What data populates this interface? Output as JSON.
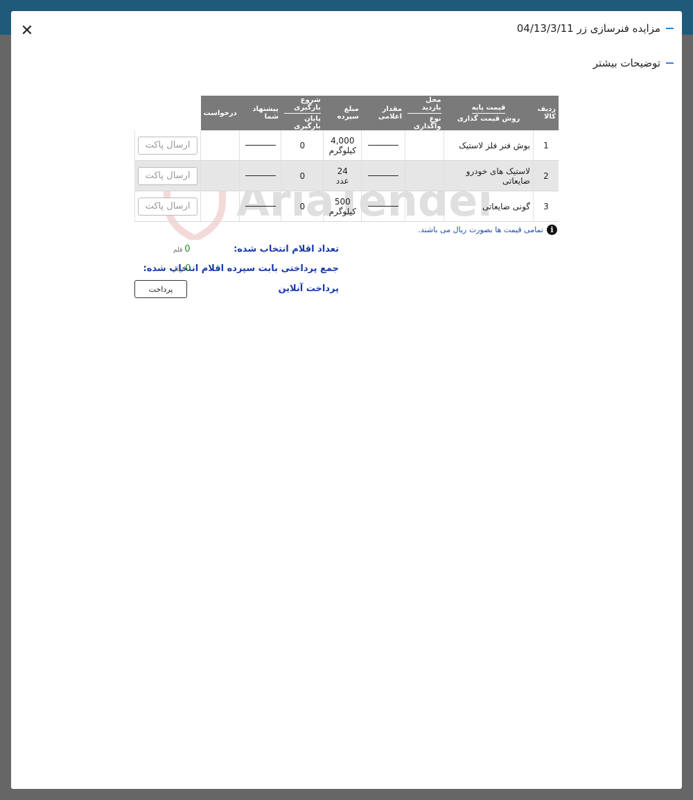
{
  "modal": {
    "title": "مزایده فنرسازی زر 04/13/3/11",
    "more_details": "توضیحات بیشتر"
  },
  "table": {
    "headers": {
      "row_item": "ردیف کالا",
      "base_price": "قیمت پایه",
      "pricing_method": "روش قیمت گذاری",
      "visit_location": "محل بازدید",
      "transfer_type": "نوع واگذاری",
      "announced_amount": "مقدار اعلامی",
      "deposit_amount": "مبلغ سپرده",
      "loading_start": "شروع بارگیری",
      "loading_end": "پایان بارگیری",
      "your_offer": "پیشنهاد شما",
      "request": "درخواست"
    },
    "rows": [
      {
        "num": "1",
        "name": "بوش فنر فلز لاستیک",
        "amount": "4,000",
        "unit": "کیلوگرم",
        "deposit": "0",
        "send": "ارسال پاکت"
      },
      {
        "num": "2",
        "name": "لاستیک های خودرو ضایعاتی",
        "amount": "24",
        "unit": "عدد",
        "deposit": "0",
        "send": "ارسال پاکت"
      },
      {
        "num": "3",
        "name": "گونی ضایعاتی",
        "amount": "500",
        "unit": "کیلوگرم",
        "deposit": "0",
        "send": "ارسال پاکت"
      }
    ]
  },
  "note": "تمامی قیمت ها بصورت ریال می باشند.",
  "summary": {
    "selected_count_label": "تعداد اقلام انتخاب شده:",
    "selected_count_value": "0",
    "selected_count_unit": "قلم",
    "deposit_total_label": "جمع پرداختی بابت سپرده اقلام انتخاب شده:",
    "deposit_total_value": "0",
    "deposit_total_unit": "ریال",
    "online_payment_label": "پرداخت آنلاین",
    "pay_button": "پرداخت"
  },
  "watermark_text": "AriaTender.net",
  "colors": {
    "accent": "#3b7dd8",
    "header_bg": "#7a7a7a",
    "label_blue": "#1a3aa8",
    "value_green": "#1e8a1e"
  }
}
